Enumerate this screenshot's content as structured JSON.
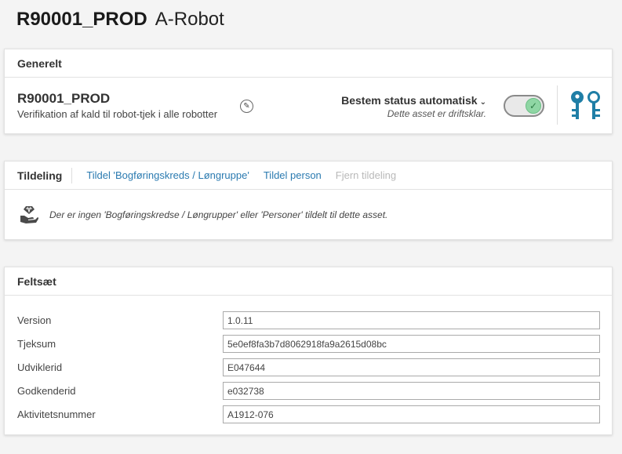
{
  "header": {
    "asset_id": "R90001_PROD",
    "asset_type": "A-Robot"
  },
  "general": {
    "title": "Generelt",
    "name": "R90001_PROD",
    "description": "Verifikation af kald til robot-tjek i alle robotter",
    "edit_icon": "pencil-icon",
    "status_label": "Bestem status automatisk",
    "status_sub": "Dette asset er driftsklar.",
    "toggle_on": true,
    "keys_icon": "keys-icon",
    "accent_color": "#1f7ea6"
  },
  "assignment": {
    "title": "Tildeling",
    "link_group": "Tildel 'Bogføringskreds / Løngruppe'",
    "link_person": "Tildel person",
    "link_remove": "Fjern tildeling",
    "empty_message": "Der er ingen 'Bogføringskredse / Løngrupper' eller 'Personer' tildelt til dette asset.",
    "empty_icon": "hand-box-icon"
  },
  "fieldset": {
    "title": "Feltsæt",
    "fields": [
      {
        "label": "Version",
        "value": "1.0.11"
      },
      {
        "label": "Tjeksum",
        "value": "5e0ef8fa3b7d8062918fa9a2615d08bc"
      },
      {
        "label": "Udviklerid",
        "value": "E047644"
      },
      {
        "label": "Godkenderid",
        "value": "e032738"
      },
      {
        "label": "Aktivitetsnummer",
        "value": "A1912-076"
      }
    ]
  }
}
